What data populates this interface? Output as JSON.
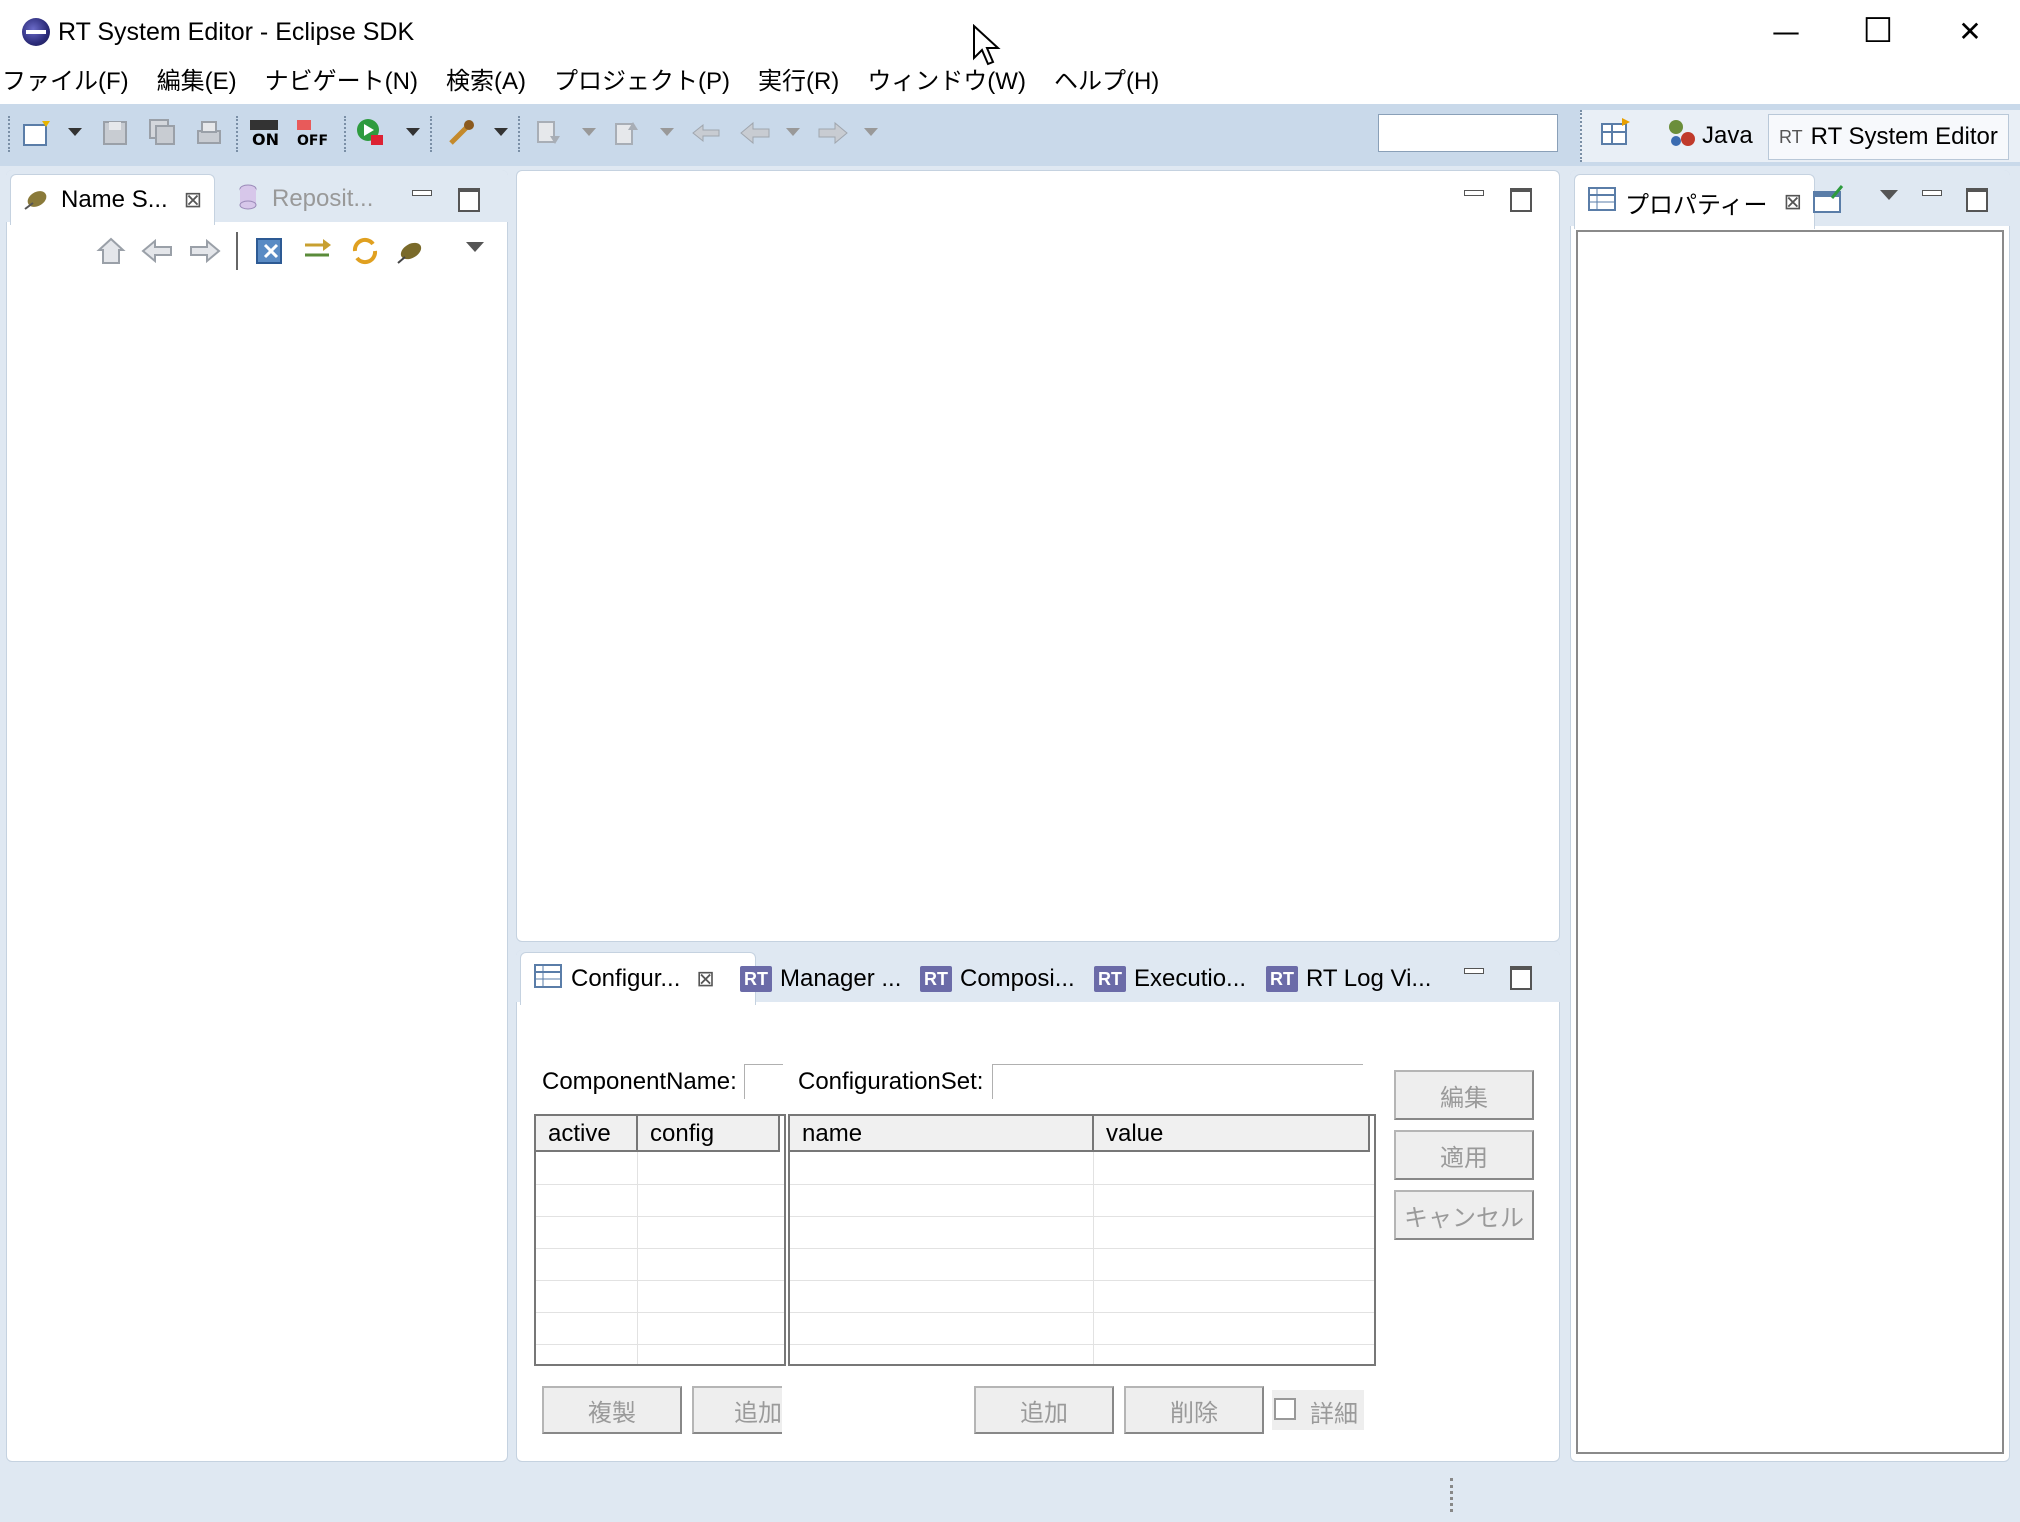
{
  "window": {
    "title": "RT System Editor - Eclipse SDK",
    "minimize": "—",
    "maximize": "☐",
    "close": "✕"
  },
  "menu": [
    "ファイル(F)",
    "編集(E)",
    "ナビゲート(N)",
    "検索(A)",
    "プロジェクト(P)",
    "実行(R)",
    "ウィンドウ(W)",
    "ヘルプ(H)"
  ],
  "perspectives": {
    "java": "Java",
    "rt_badge": "RT",
    "rt_system_editor": "RT System Editor"
  },
  "left_panel": {
    "tab_active": "Name S...",
    "tab_inactive": "Reposit..."
  },
  "bottom_panel": {
    "tabs": [
      "Configur...",
      "Manager ...",
      "Composi...",
      "Executio...",
      "RT Log Vi..."
    ],
    "rt_badge": "RT",
    "component_name_label": "ComponentName:",
    "configuration_set_label": "ConfigurationSet:",
    "left_table_headers": [
      "active",
      "config"
    ],
    "right_table_headers": [
      "name",
      "value"
    ],
    "buttons": {
      "edit": "編集",
      "apply": "適用",
      "cancel": "キャンセル",
      "duplicate": "複製",
      "add_left": "追加",
      "add_right": "追加",
      "delete": "削除",
      "detail": "詳細"
    }
  },
  "right_panel": {
    "tab": "プロパティー"
  }
}
